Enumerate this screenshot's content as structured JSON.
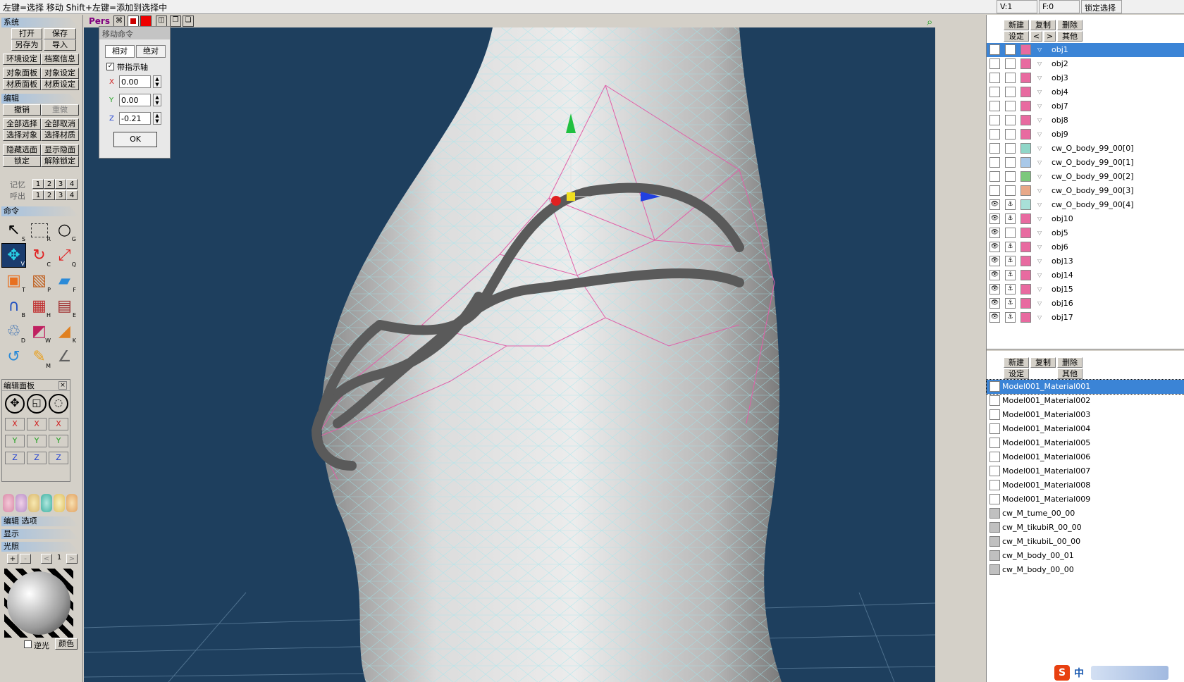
{
  "topbar": {
    "hint": "左键=选择 移动  Shift+左键=添加到选择中",
    "status": [
      "V:1",
      "F:0",
      "锁定选择"
    ]
  },
  "left": {
    "system_title": "系统",
    "system_buttons": [
      "打开",
      "保存",
      "另存为",
      "导入",
      "环境设定",
      "档案信息",
      "对象面板",
      "对象设定",
      "材质面板",
      "材质设定"
    ],
    "edit_title": "编辑",
    "undo": "撤销",
    "redo": "重做",
    "edit_buttons": [
      "全部选择",
      "全部取消",
      "选择对象",
      "选择材质",
      "隐藏选面",
      "显示隐面",
      "锁定",
      "解除锁定"
    ],
    "memory_label": "记忆",
    "recall_label": "呼出",
    "nums": [
      "1",
      "2",
      "3",
      "4"
    ],
    "command_title": "命令",
    "tool_letters": [
      "S",
      "R",
      "G",
      "V",
      "C",
      "Q",
      "T",
      "P",
      "F",
      "B",
      "H",
      "E",
      "D",
      "W",
      "K",
      "",
      "M",
      ""
    ],
    "panel_title": "编辑面板",
    "axes": [
      "X",
      "Y",
      "Z"
    ],
    "edit_options": "编辑 选项",
    "display": "显示",
    "light": "光照",
    "light_page": "1",
    "backlight": "逆光",
    "color": "颜色"
  },
  "viewport": {
    "view_name": "Pers"
  },
  "dialog": {
    "title": "移动命令",
    "tab_relative": "相对",
    "tab_absolute": "绝对",
    "show_axis": "带指示轴",
    "x_label": "X",
    "y_label": "Y",
    "z_label": "Z",
    "x": "0.00",
    "y": "0.00",
    "z": "-0.21",
    "ok": "OK"
  },
  "objects": {
    "buttons": [
      "新建",
      "复制",
      "删除",
      "设定",
      "<",
      ">",
      "其他"
    ],
    "items": [
      {
        "name": "obj1",
        "color": "#e86aa0",
        "visible": false,
        "locked": false,
        "selected": true
      },
      {
        "name": "obj2",
        "color": "#e86aa0",
        "visible": false,
        "locked": false
      },
      {
        "name": "obj3",
        "color": "#e86aa0",
        "visible": false,
        "locked": false
      },
      {
        "name": "obj4",
        "color": "#e86aa0",
        "visible": false,
        "locked": false
      },
      {
        "name": "obj7",
        "color": "#e86aa0",
        "visible": false,
        "locked": false
      },
      {
        "name": "obj8",
        "color": "#e86aa0",
        "visible": false,
        "locked": false
      },
      {
        "name": "obj9",
        "color": "#e86aa0",
        "visible": false,
        "locked": false
      },
      {
        "name": "cw_O_body_99_00[0]",
        "color": "#8fd6c8",
        "visible": false,
        "locked": false
      },
      {
        "name": "cw_O_body_99_00[1]",
        "color": "#a8c8e8",
        "visible": false,
        "locked": false
      },
      {
        "name": "cw_O_body_99_00[2]",
        "color": "#7cc87c",
        "visible": false,
        "locked": false
      },
      {
        "name": "cw_O_body_99_00[3]",
        "color": "#e8a888",
        "visible": false,
        "locked": false
      },
      {
        "name": "cw_O_body_99_00[4]",
        "color": "#a8e0d8",
        "visible": true,
        "locked": true
      },
      {
        "name": "obj10",
        "color": "#e86aa0",
        "visible": true,
        "locked": true
      },
      {
        "name": "obj5",
        "color": "#e86aa0",
        "visible": true,
        "locked": false
      },
      {
        "name": "obj6",
        "color": "#e86aa0",
        "visible": true,
        "locked": true
      },
      {
        "name": "obj13",
        "color": "#e86aa0",
        "visible": true,
        "locked": true
      },
      {
        "name": "obj14",
        "color": "#e86aa0",
        "visible": true,
        "locked": true
      },
      {
        "name": "obj15",
        "color": "#e86aa0",
        "visible": true,
        "locked": true
      },
      {
        "name": "obj16",
        "color": "#e86aa0",
        "visible": true,
        "locked": true
      },
      {
        "name": "obj17",
        "color": "#e86aa0",
        "visible": true,
        "locked": true
      }
    ]
  },
  "materials": {
    "buttons": [
      "新建",
      "复制",
      "删除",
      "设定",
      "其他"
    ],
    "items": [
      {
        "name": "Model001_Material001",
        "selected": true,
        "gray": false
      },
      {
        "name": "Model001_Material002",
        "gray": false
      },
      {
        "name": "Model001_Material003",
        "gray": false
      },
      {
        "name": "Model001_Material004",
        "gray": false
      },
      {
        "name": "Model001_Material005",
        "gray": false
      },
      {
        "name": "Model001_Material006",
        "gray": false
      },
      {
        "name": "Model001_Material007",
        "gray": false
      },
      {
        "name": "Model001_Material008",
        "gray": false
      },
      {
        "name": "Model001_Material009",
        "gray": false
      },
      {
        "name": "cw_M_tume_00_00",
        "gray": true
      },
      {
        "name": "cw_M_tikubiR_00_00",
        "gray": true
      },
      {
        "name": "cw_M_tikubiL_00_00",
        "gray": true
      },
      {
        "name": "cw_M_body_00_01",
        "gray": true
      },
      {
        "name": "cw_M_body_00_00",
        "gray": true
      }
    ]
  },
  "taskbar": {
    "ime_label": "中"
  }
}
